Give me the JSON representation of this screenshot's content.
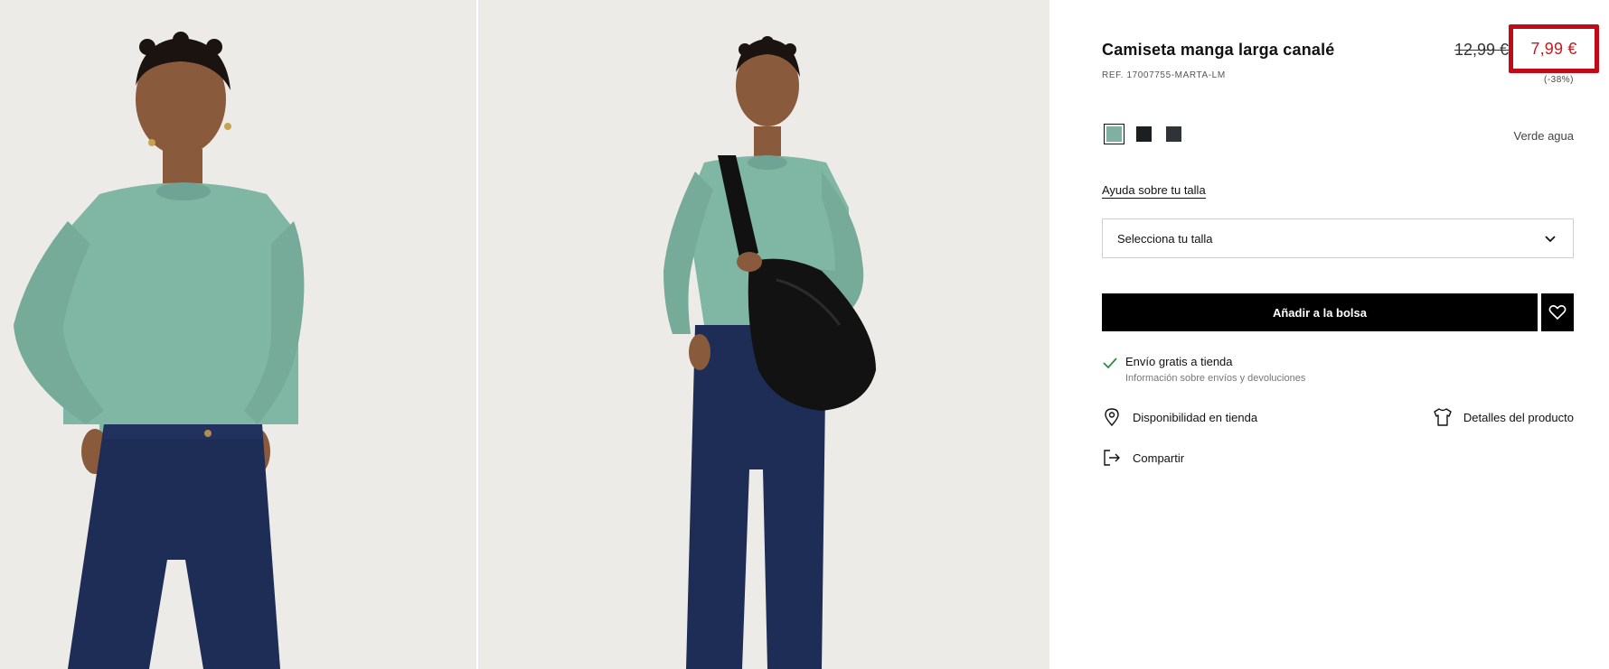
{
  "product": {
    "title": "Camiseta manga larga canalé",
    "ref": "REF. 17007755-MARTA-LM",
    "old_price": "12,99 €",
    "price": "7,99 €",
    "discount": "(-38%)"
  },
  "colors": {
    "selected_name": "Verde agua",
    "swatches": [
      {
        "name": "verde-agua",
        "hex": "#7fb0a2"
      },
      {
        "name": "negro",
        "hex": "#1c1f22"
      },
      {
        "name": "gris-oscuro",
        "hex": "#2f3236"
      }
    ]
  },
  "size": {
    "help_link": "Ayuda sobre tu talla",
    "select_placeholder": "Selecciona tu talla"
  },
  "actions": {
    "add_to_bag": "Añadir a la bolsa",
    "shipping_title": "Envío gratis a tienda",
    "shipping_info": "Información sobre envíos y devoluciones",
    "store_availability": "Disponibilidad en tienda",
    "product_details": "Detalles del producto",
    "share": "Compartir"
  },
  "style": {
    "accent_red": "#c00a17",
    "price_red": "#c41a24",
    "check_green": "#2e8b3e",
    "shirt_color": "#7fb6a4",
    "denim_color": "#1d2d55"
  }
}
